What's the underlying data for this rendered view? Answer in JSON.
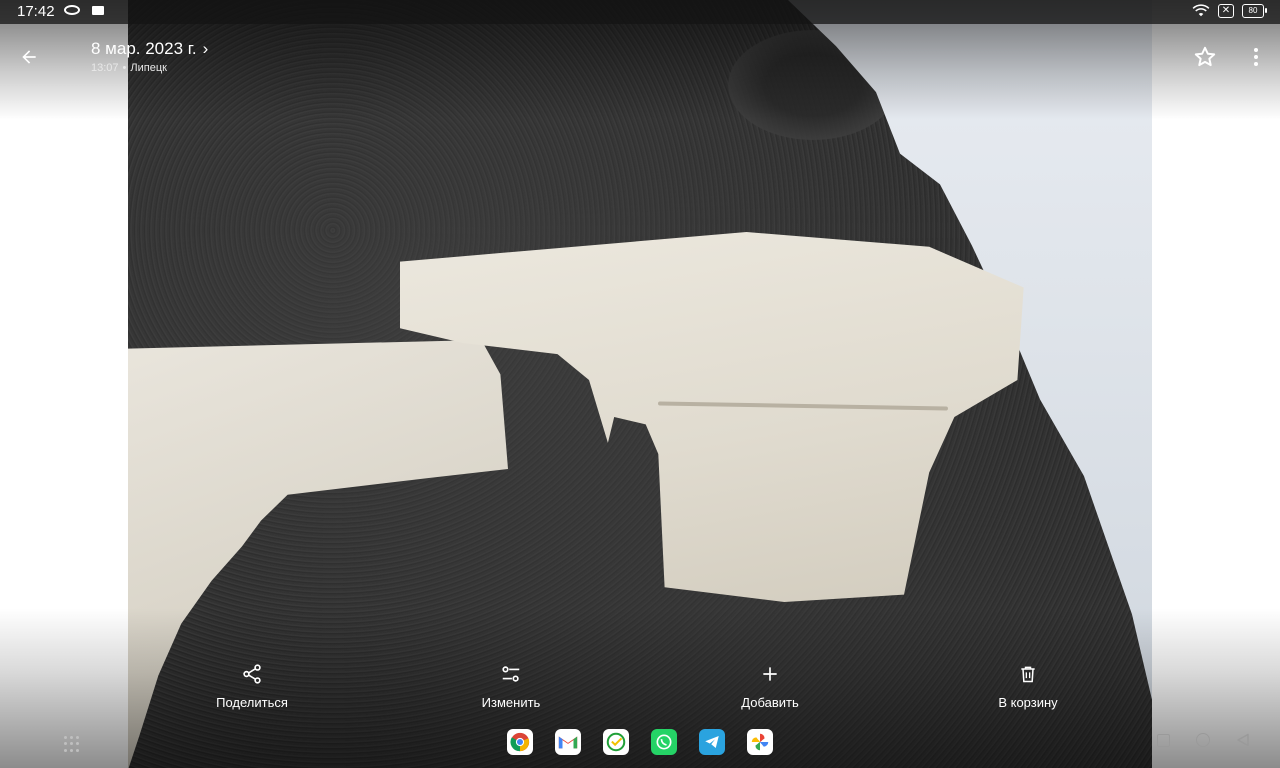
{
  "status_bar": {
    "time": "17:42",
    "battery": "80",
    "icons": [
      "ring-icon",
      "notification-square-icon",
      "wifi-icon",
      "no-sim-icon",
      "battery-icon"
    ]
  },
  "header": {
    "date": "8 мар. 2023 г.",
    "chevron": "›",
    "time": "13:07",
    "separator": "•",
    "location": "Липецк",
    "icons": [
      "back-arrow-icon",
      "star-icon",
      "more-vert-icon"
    ]
  },
  "actions": [
    {
      "label": "Поделиться",
      "icon": "share-icon"
    },
    {
      "label": "Изменить",
      "icon": "edit-sliders-icon"
    },
    {
      "label": "Добавить",
      "icon": "plus-icon"
    },
    {
      "label": "В корзину",
      "icon": "trash-icon"
    }
  ],
  "dock": [
    "chrome-icon",
    "gmail-icon",
    "sber-icon",
    "whatsapp-icon",
    "telegram-icon",
    "google-photos-icon"
  ],
  "colors": {
    "overlay_text": "#ffffff",
    "nav_gray": "#9a9a9a"
  }
}
